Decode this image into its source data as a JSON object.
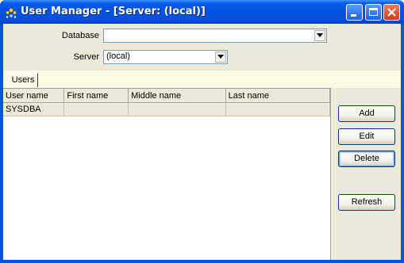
{
  "window": {
    "title": "User Manager - [Server: (local)]",
    "icons": {
      "app": "users-app-icon",
      "minimize": "minimize-icon",
      "maximize": "maximize-icon",
      "close": "close-icon"
    }
  },
  "form": {
    "database_label": "Database",
    "database_value": "",
    "server_label": "Server",
    "server_value": "(local)"
  },
  "tabs": [
    {
      "label": "Users"
    }
  ],
  "users_table": {
    "columns": [
      "User name",
      "First name",
      "Middle name",
      "Last name"
    ],
    "rows": [
      {
        "user_name": "SYSDBA",
        "first_name": "",
        "middle_name": "",
        "last_name": ""
      }
    ]
  },
  "actions": {
    "add": "Add",
    "edit": "Edit",
    "delete": "Delete",
    "refresh": "Refresh"
  },
  "colors": {
    "titlebar": "#0053e1",
    "client_bg": "#ece9d8",
    "tabstrip_bg": "#fcfbe8",
    "close_button": "#c8401a"
  }
}
